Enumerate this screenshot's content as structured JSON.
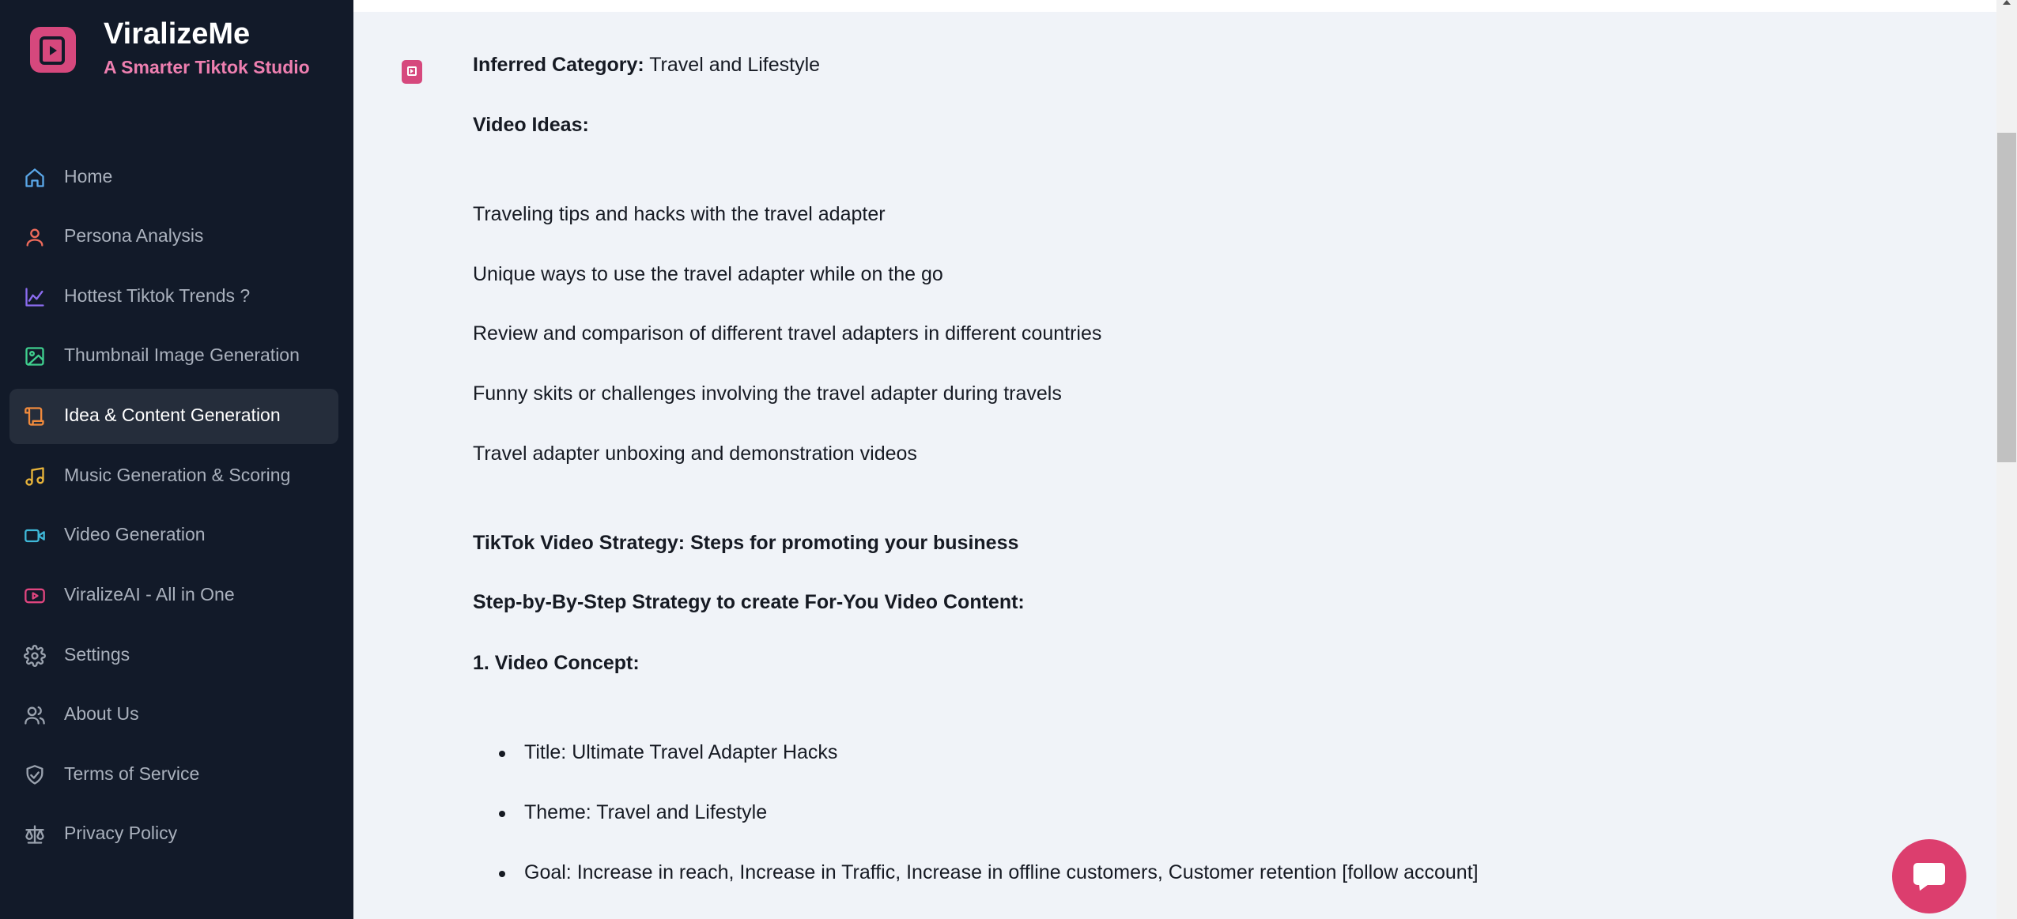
{
  "app": {
    "name": "ViralizeMe",
    "tagline": "A Smarter Tiktok Studio",
    "brand_color": "#d6487d",
    "tagline_color": "#ee7fb0"
  },
  "sidebar": {
    "items": [
      {
        "label": "Home",
        "icon": "home-icon",
        "icon_color": "#5aa7e8",
        "active": false
      },
      {
        "label": "Persona Analysis",
        "icon": "user-icon",
        "icon_color": "#ef6b5b",
        "active": false
      },
      {
        "label": "Hottest Tiktok Trends ?",
        "icon": "chart-line-icon",
        "icon_color": "#8b6cf0",
        "active": false
      },
      {
        "label": "Thumbnail Image Generation",
        "icon": "image-icon",
        "icon_color": "#3fcf8e",
        "active": false
      },
      {
        "label": "Idea & Content Generation",
        "icon": "scroll-icon",
        "icon_color": "#f08a3c",
        "active": true
      },
      {
        "label": "Music Generation & Scoring",
        "icon": "music-icon",
        "icon_color": "#e8b43a",
        "active": false
      },
      {
        "label": "Video Generation",
        "icon": "video-icon",
        "icon_color": "#3fb8d8",
        "active": false
      },
      {
        "label": "ViralizeAI - All in One",
        "icon": "youtube-icon",
        "icon_color": "#e0457f",
        "active": false
      },
      {
        "label": "Settings",
        "icon": "gear-icon",
        "icon_color": "#9aa2ae",
        "active": false
      },
      {
        "label": "About Us",
        "icon": "users-icon",
        "icon_color": "#9aa2ae",
        "active": false
      },
      {
        "label": "Terms of Service",
        "icon": "handshake-icon",
        "icon_color": "#9aa2ae",
        "active": false
      },
      {
        "label": "Privacy Policy",
        "icon": "scale-icon",
        "icon_color": "#9aa2ae",
        "active": false
      }
    ]
  },
  "message": {
    "inferred_label": "Inferred Category:",
    "inferred_value": "Travel and Lifestyle",
    "video_ideas_heading": "Video Ideas:",
    "video_ideas": [
      "Traveling tips and hacks with the travel adapter",
      "Unique ways to use the travel adapter while on the go",
      "Review and comparison of different travel adapters in different countries",
      "Funny skits or challenges involving the travel adapter during travels",
      "Travel adapter unboxing and demonstration videos"
    ],
    "strategy_heading": "TikTok Video Strategy: Steps for promoting your business",
    "step_heading": "Step-by-By-Step Strategy to create For-You Video Content:",
    "concept_heading": "1. Video Concept:",
    "concept_bullets": [
      "Title: Ultimate Travel Adapter Hacks",
      "Theme: Travel and Lifestyle",
      "Goal: Increase in reach, Increase in Traffic, Increase in offline customers, Customer retention [follow account]"
    ]
  },
  "chat": {
    "icon": "chat-bubble-icon",
    "color": "#dc3e6e"
  }
}
